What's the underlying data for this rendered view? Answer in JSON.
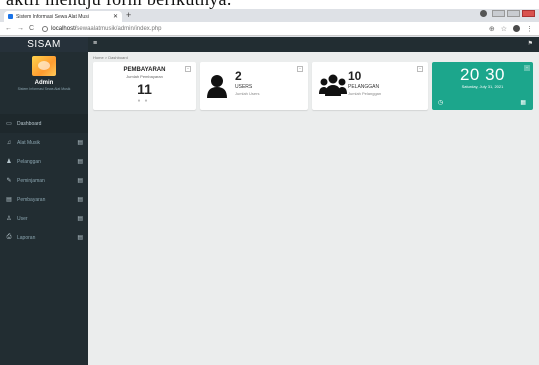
{
  "caption_fragment": "aktif menuju form berikutnya.",
  "browser": {
    "tab_title": "Sistem Informasi Sewa Alat Musi",
    "url_host": "localhost/",
    "url_path": "sewaalatmusik/admin/index.php"
  },
  "app": {
    "brand": "SISAM",
    "user": {
      "name": "Admin",
      "subtitle": "Sistem Informasi Sewa Alat Musik"
    },
    "breadcrumb": "Home > Dashboard",
    "menu": [
      {
        "label": "Dashboard",
        "icon": "monitor-icon",
        "glyph": "▭",
        "has_caret": false,
        "active": true
      },
      {
        "label": "Alat Musik",
        "icon": "music-note-icon",
        "glyph": "♫",
        "has_caret": true,
        "active": false
      },
      {
        "label": "Pelanggan",
        "icon": "users-icon",
        "glyph": "♟",
        "has_caret": true,
        "active": false
      },
      {
        "label": "Peminjaman",
        "icon": "edit-icon",
        "glyph": "✎",
        "has_caret": true,
        "active": false
      },
      {
        "label": "Pembayaran",
        "icon": "money-icon",
        "glyph": "▤",
        "has_caret": true,
        "active": false
      },
      {
        "label": "User",
        "icon": "user-icon",
        "glyph": "♙",
        "has_caret": true,
        "active": false
      },
      {
        "label": "Laporan",
        "icon": "print-icon",
        "glyph": "⎙",
        "has_caret": true,
        "active": false
      }
    ],
    "cards": {
      "pembayaran": {
        "title": "PEMBAYARAN",
        "subtitle": "Jumlah Pembayaran",
        "value": "11"
      },
      "users": {
        "value": "2",
        "label": "USERS",
        "subtitle": "Jumlah Users"
      },
      "pelanggan": {
        "value": "10",
        "label": "PELANGGAN",
        "subtitle": "Jumlah Pelanggan"
      }
    },
    "clock": {
      "time": "20 30",
      "date": "Saturday, July 31, 2021"
    }
  },
  "colors": {
    "sidebar": "#222d32",
    "clock_bg": "#1ca68c",
    "content_bg": "#ebeded"
  }
}
